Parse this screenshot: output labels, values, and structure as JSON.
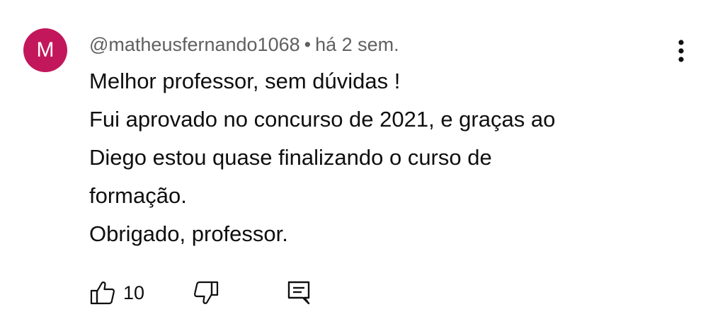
{
  "comment": {
    "avatar_letter": "M",
    "avatar_color": "#c2185b",
    "author": "@matheusfernando1068",
    "separator": "•",
    "timestamp": "há 2 sem.",
    "body_lines": [
      "Melhor professor, sem dúvidas !",
      "Fui aprovado no concurso de 2021, e graças ao",
      "Diego estou quase finalizando o curso de",
      "formação.",
      "Obrigado, professor."
    ],
    "like_count": "10"
  },
  "icons": {
    "menu": "more-vert-icon",
    "like": "thumb-up-icon",
    "dislike": "thumb-down-icon",
    "reply": "comment-reply-icon"
  }
}
